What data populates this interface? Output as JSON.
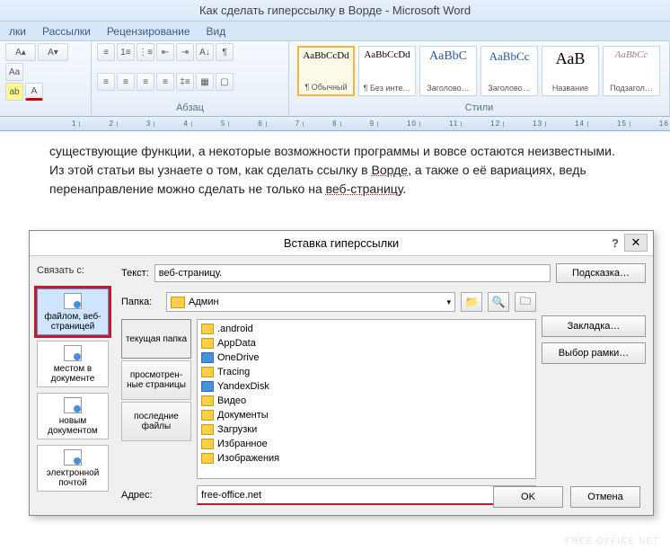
{
  "title": "Как сделать гиперссылку в Ворде - Microsoft Word",
  "ribbon_tabs": [
    "лки",
    "Рассылки",
    "Рецензирование",
    "Вид"
  ],
  "ribbon_groups": {
    "paragraph": "Абзац",
    "styles": "Стили"
  },
  "styles": [
    {
      "sample": "AaBbCcDd",
      "label": "¶ Обычный",
      "active": true
    },
    {
      "sample": "AaBbCcDd",
      "label": "¶ Без инте…",
      "active": false
    },
    {
      "sample": "AaBbC",
      "label": "Заголово…",
      "active": false
    },
    {
      "sample": "AaBbCc",
      "label": "Заголово…",
      "active": false
    },
    {
      "sample": "АаВ",
      "label": "Название",
      "active": false
    },
    {
      "sample": "AaBbCc",
      "label": "Подзагол…",
      "active": false
    }
  ],
  "ruler_marks": [
    "1",
    "2",
    "3",
    "4",
    "5",
    "6",
    "7",
    "8",
    "9",
    "10",
    "11",
    "12",
    "13",
    "14",
    "15",
    "16"
  ],
  "doc_lines": {
    "l1a": "существующие функции, а некоторые возможности программы и вовсе остаются неизвестными.",
    "l2a": "Из этой статьи вы узнаете о том, как сделать ссылку в ",
    "l2b": "Ворде",
    "l2c": ", а также о её вариациях, ведь",
    "l3a": "перенаправление можно сделать не только на ",
    "l3b": "веб-страницу",
    "l3c": "."
  },
  "dialog": {
    "title": "Вставка гиперссылки",
    "help": "?",
    "close": "✕",
    "linkto_label": "Связать с:",
    "text_label": "Текст:",
    "text_value": "веб-страницу.",
    "hint_btn": "Подсказка…",
    "linkto_items": [
      "файлом, веб-страницей",
      "местом в документе",
      "новым документом",
      "электронной почтой"
    ],
    "folder_label": "Папка:",
    "folder_value": "Админ",
    "browse_tabs": [
      "текущая папка",
      "просмотрен-ные страницы",
      "последние файлы"
    ],
    "files": [
      ".android",
      "AppData",
      "OneDrive",
      "Tracing",
      "YandexDisk",
      "Видео",
      "Документы",
      "Загрузки",
      "Избранное",
      "Изображения"
    ],
    "side_btns": [
      "Закладка…",
      "Выбор рамки…"
    ],
    "addr_label": "Адрес:",
    "addr_value": "free-office.net",
    "ok": "OK",
    "cancel": "Отмена"
  },
  "watermark": "FREE-OFFICE.NET"
}
